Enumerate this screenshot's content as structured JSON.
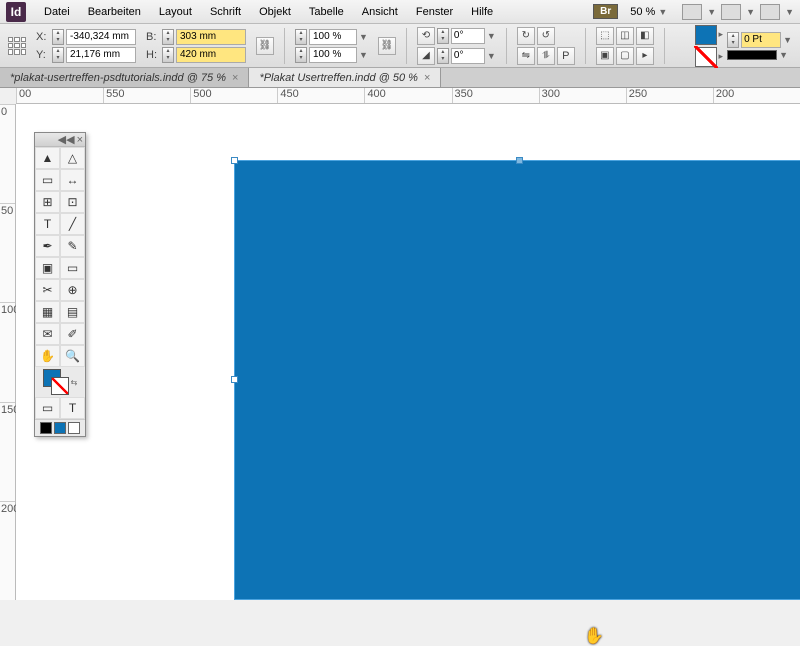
{
  "app": {
    "logo": "Id"
  },
  "menu": {
    "items": [
      "Datei",
      "Bearbeiten",
      "Layout",
      "Schrift",
      "Objekt",
      "Tabelle",
      "Ansicht",
      "Fenster",
      "Hilfe"
    ],
    "bridge": "Br",
    "zoom": "50 %"
  },
  "control": {
    "x": "-340,324 mm",
    "y": "21,176 mm",
    "w": "303 mm",
    "h": "420 mm",
    "scaleX": "100 %",
    "scaleY": "100 %",
    "rotate": "0°",
    "shear": "0°",
    "strokeWeight": "0 Pt"
  },
  "tabs": [
    {
      "label": "*plakat-usertreffen-psdtutorials.indd @ 75 %",
      "active": false
    },
    {
      "label": "*Plakat Usertreffen.indd @ 50 %",
      "active": true
    }
  ],
  "rulerH": [
    "00",
    "550",
    "500",
    "450",
    "400",
    "350",
    "300",
    "250",
    "200"
  ],
  "rulerV": [
    "0",
    "50",
    "100",
    "150",
    "200"
  ],
  "tools": {
    "rows": [
      [
        "select",
        "direct-select"
      ],
      [
        "page",
        "gap"
      ],
      [
        "content-collect",
        "content-place"
      ],
      [
        "type",
        "line"
      ],
      [
        "pen",
        "pencil"
      ],
      [
        "rect-frame",
        "rect"
      ],
      [
        "scissors",
        "transform"
      ],
      [
        "gradient-swatch",
        "gradient-feather"
      ],
      [
        "note",
        "eyedropper"
      ],
      [
        "hand",
        "zoom"
      ]
    ],
    "glyphs": {
      "select": "▲",
      "direct-select": "△",
      "page": "▭",
      "gap": "↔",
      "content-collect": "⊞",
      "content-place": "⊡",
      "type": "T",
      "line": "╱",
      "pen": "✒",
      "pencil": "✎",
      "rect-frame": "▣",
      "rect": "▭",
      "scissors": "✂",
      "transform": "⊕",
      "gradient-swatch": "▦",
      "gradient-feather": "▤",
      "note": "✉",
      "eyedropper": "✐",
      "hand": "✋",
      "zoom": "🔍"
    },
    "bottom": [
      "■",
      "■",
      "⊡"
    ]
  },
  "colors": {
    "fill": "#0d73b5",
    "canvas": "#ffffff"
  }
}
